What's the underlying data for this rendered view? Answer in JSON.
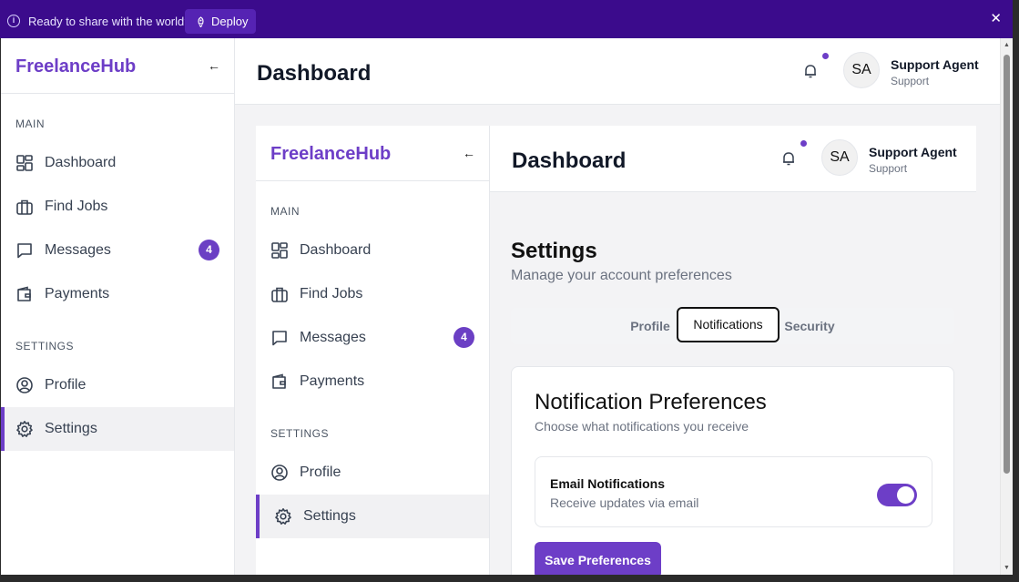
{
  "banner": {
    "message": "Ready to share with the world?",
    "deploy_label": "Deploy"
  },
  "brand": "FreelanceHub",
  "collapse_glyph": "←",
  "sidebar": {
    "main_label": "MAIN",
    "settings_label": "SETTINGS",
    "items": [
      {
        "label": "Dashboard",
        "icon": "dashboard-icon"
      },
      {
        "label": "Find Jobs",
        "icon": "briefcase-icon"
      },
      {
        "label": "Messages",
        "icon": "message-icon",
        "badge": "4"
      },
      {
        "label": "Payments",
        "icon": "wallet-icon"
      },
      {
        "label": "Profile",
        "icon": "user-circle-icon"
      },
      {
        "label": "Settings",
        "icon": "gear-icon",
        "active": true
      }
    ]
  },
  "header": {
    "title": "Dashboard",
    "avatar_initials": "SA",
    "user_name": "Support Agent",
    "user_role": "Support"
  },
  "settings": {
    "title": "Settings",
    "subtitle": "Manage your account preferences",
    "tabs": [
      {
        "label": "Profile"
      },
      {
        "label": "Notifications",
        "active": true
      },
      {
        "label": "Security"
      }
    ]
  },
  "notifications": {
    "title": "Notification Preferences",
    "subtitle": "Choose what notifications you receive",
    "email_title": "Email Notifications",
    "email_desc": "Receive updates via email",
    "email_enabled": true,
    "save_label": "Save Preferences"
  },
  "colors": {
    "accent": "#6d3ec7",
    "banner": "#3b0b8c"
  }
}
